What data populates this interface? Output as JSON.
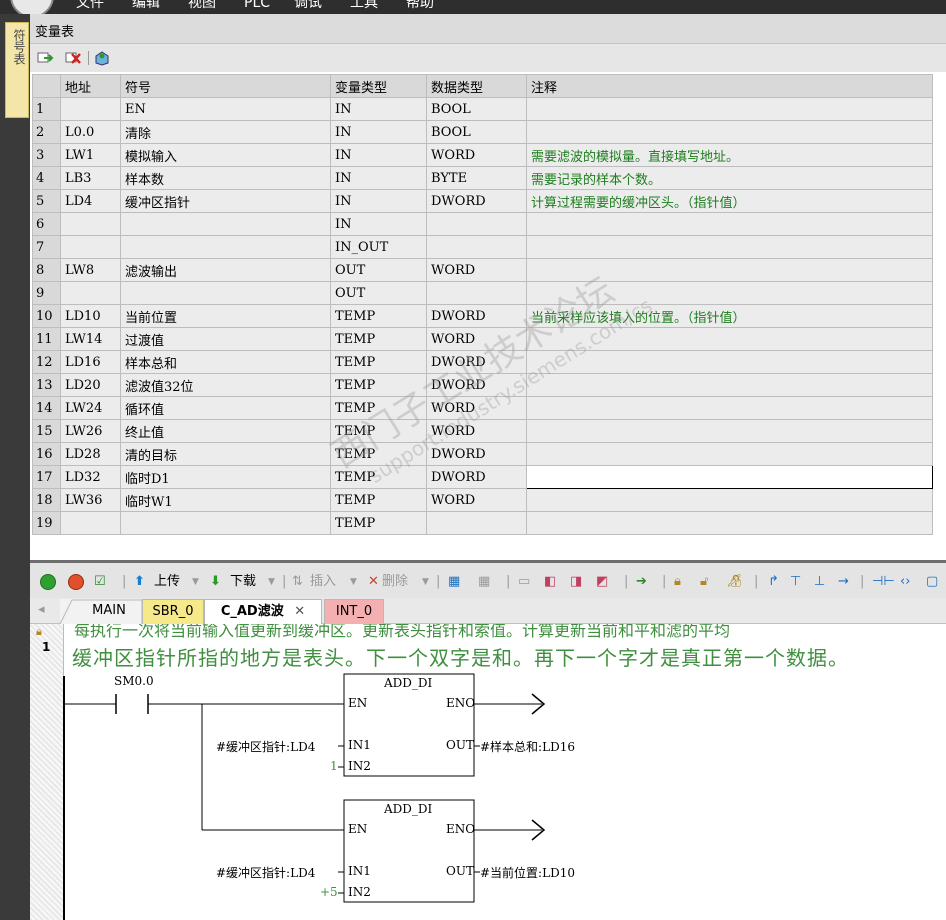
{
  "menu": {
    "items": [
      "文件",
      "编辑",
      "视图",
      "PLC",
      "调试",
      "工具",
      "帮助"
    ]
  },
  "dock": {
    "tab": "符号表"
  },
  "var_table": {
    "title": "变量表",
    "headers": [
      "",
      "地址",
      "符号",
      "变量类型",
      "数据类型",
      "注释"
    ],
    "rows": [
      [
        "1",
        "",
        "EN",
        "IN",
        "BOOL",
        ""
      ],
      [
        "2",
        "L0.0",
        "清除",
        "IN",
        "BOOL",
        ""
      ],
      [
        "3",
        "LW1",
        "模拟输入",
        "IN",
        "WORD",
        "需要滤波的模拟量。直接填写地址。"
      ],
      [
        "4",
        "LB3",
        "样本数",
        "IN",
        "BYTE",
        "需要记录的样本个数。"
      ],
      [
        "5",
        "LD4",
        "缓冲区指针",
        "IN",
        "DWORD",
        "计算过程需要的缓冲区头。（指针值）"
      ],
      [
        "6",
        "",
        "",
        "IN",
        "",
        ""
      ],
      [
        "7",
        "",
        "",
        "IN_OUT",
        "",
        ""
      ],
      [
        "8",
        "LW8",
        "滤波输出",
        "OUT",
        "WORD",
        ""
      ],
      [
        "9",
        "",
        "",
        "OUT",
        "",
        ""
      ],
      [
        "10",
        "LD10",
        "当前位置",
        "TEMP",
        "DWORD",
        "当前采样应该填入的位置。（指针值）"
      ],
      [
        "11",
        "LW14",
        "过渡值",
        "TEMP",
        "WORD",
        ""
      ],
      [
        "12",
        "LD16",
        "样本总和",
        "TEMP",
        "DWORD",
        ""
      ],
      [
        "13",
        "LD20",
        "滤波值32位",
        "TEMP",
        "DWORD",
        ""
      ],
      [
        "14",
        "LW24",
        "循环值",
        "TEMP",
        "WORD",
        ""
      ],
      [
        "15",
        "LW26",
        "终止值",
        "TEMP",
        "WORD",
        ""
      ],
      [
        "16",
        "LD28",
        "清的目标",
        "TEMP",
        "DWORD",
        ""
      ],
      [
        "17",
        "LD32",
        "临时D1",
        "TEMP",
        "DWORD",
        ""
      ],
      [
        "18",
        "LW36",
        "临时W1",
        "TEMP",
        "WORD",
        ""
      ],
      [
        "19",
        "",
        "",
        "TEMP",
        "",
        ""
      ]
    ]
  },
  "watermark": {
    "line1": "西门子工业技术论坛",
    "line2": "support.industry.siemens.com/cs"
  },
  "prog_toolbar": {
    "upload": "上传",
    "download": "下载",
    "insert": "插入",
    "delete": "删除"
  },
  "prog_tabs": [
    "MAIN",
    "SBR_0",
    "C_AD滤波",
    "INT_0"
  ],
  "editor": {
    "network_number": "1",
    "hidden_comment": "每执行一次将当前输入值更新到缓冲区。更新表头指针和索值。计算更新当前和平和滤的平均",
    "comment": "缓冲区指针所指的地方是表头。下一个双字是和。再下一个字才是真正第一个数据。",
    "contact": "SM0.0",
    "box1": {
      "name": "ADD_DI",
      "en": "EN",
      "eno": "ENO",
      "in1": "IN1",
      "in2": "IN2",
      "out": "OUT",
      "in1_var": "#缓冲区指针:LD4",
      "in2_val": "1",
      "out_var": "#样本总和:LD16"
    },
    "box2": {
      "name": "ADD_DI",
      "en": "EN",
      "eno": "ENO",
      "in1": "IN1",
      "in2": "IN2",
      "out": "OUT",
      "in1_var": "#缓冲区指针:LD4",
      "in2_val": "+5",
      "out_var": "#当前位置:LD10"
    }
  },
  "colors": {
    "comment_green": "#1e7d1e",
    "tab_active": "#f2f2f2",
    "tab_sbr": "#f5e98a",
    "tab_int": "#f4b0b0"
  }
}
